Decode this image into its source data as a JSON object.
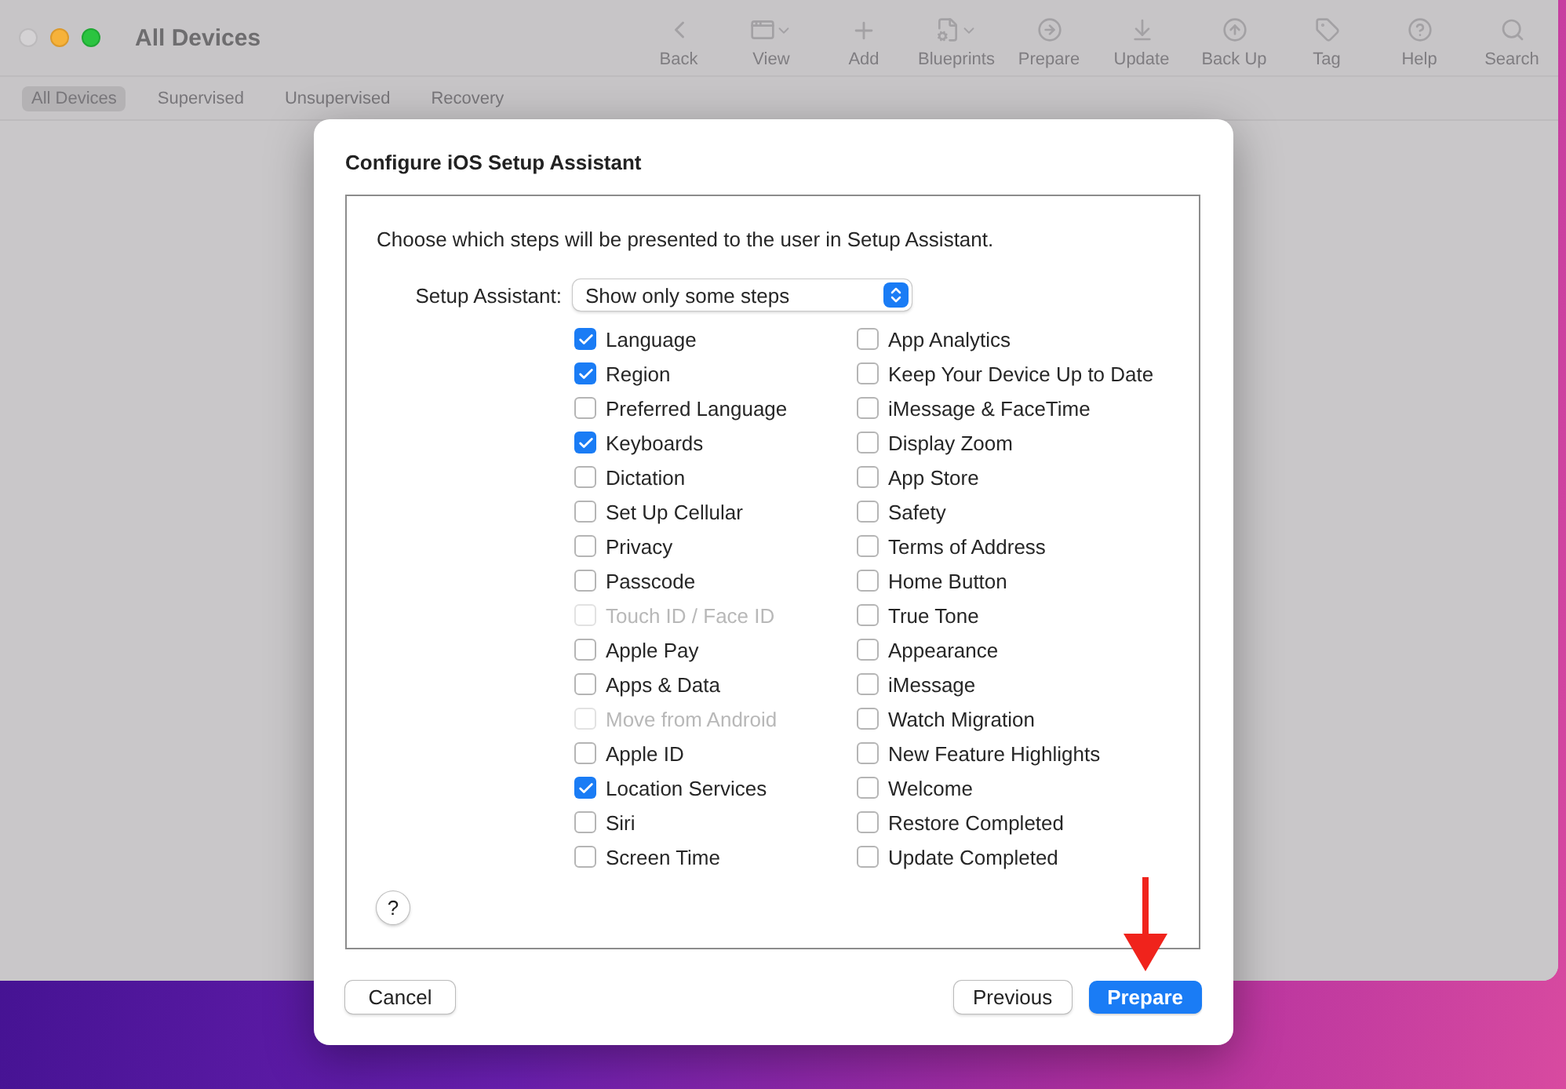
{
  "window": {
    "title": "All Devices"
  },
  "toolbar": [
    {
      "label": "Back",
      "kind": "back"
    },
    {
      "label": "View",
      "kind": "view"
    },
    {
      "label": "Add",
      "kind": "add"
    },
    {
      "label": "Blueprints",
      "kind": "blueprints"
    },
    {
      "label": "Prepare",
      "kind": "prepare"
    },
    {
      "label": "Update",
      "kind": "update"
    },
    {
      "label": "Back Up",
      "kind": "backup"
    },
    {
      "label": "Tag",
      "kind": "tag"
    },
    {
      "label": "Help",
      "kind": "help"
    },
    {
      "label": "Search",
      "kind": "search"
    }
  ],
  "tabs": [
    {
      "label": "All Devices",
      "selected": true
    },
    {
      "label": "Supervised",
      "selected": false
    },
    {
      "label": "Unsupervised",
      "selected": false
    },
    {
      "label": "Recovery",
      "selected": false
    }
  ],
  "sheet": {
    "title": "Configure iOS Setup Assistant",
    "description": "Choose which steps will be presented to the user in Setup Assistant.",
    "select_label": "Setup Assistant:",
    "select_value": "Show only some steps",
    "help": "?",
    "columns": [
      [
        {
          "label": "Language",
          "checked": true,
          "disabled": false
        },
        {
          "label": "Region",
          "checked": true,
          "disabled": false
        },
        {
          "label": "Preferred Language",
          "checked": false,
          "disabled": false
        },
        {
          "label": "Keyboards",
          "checked": true,
          "disabled": false
        },
        {
          "label": "Dictation",
          "checked": false,
          "disabled": false
        },
        {
          "label": "Set Up Cellular",
          "checked": false,
          "disabled": false
        },
        {
          "label": "Privacy",
          "checked": false,
          "disabled": false
        },
        {
          "label": "Passcode",
          "checked": false,
          "disabled": false
        },
        {
          "label": "Touch ID / Face ID",
          "checked": false,
          "disabled": true
        },
        {
          "label": "Apple Pay",
          "checked": false,
          "disabled": false
        },
        {
          "label": "Apps & Data",
          "checked": false,
          "disabled": false
        },
        {
          "label": "Move from Android",
          "checked": false,
          "disabled": true
        },
        {
          "label": "Apple ID",
          "checked": false,
          "disabled": false
        },
        {
          "label": "Location Services",
          "checked": true,
          "disabled": false
        },
        {
          "label": "Siri",
          "checked": false,
          "disabled": false
        },
        {
          "label": "Screen Time",
          "checked": false,
          "disabled": false
        }
      ],
      [
        {
          "label": "App Analytics",
          "checked": false,
          "disabled": false
        },
        {
          "label": "Keep Your Device Up to Date",
          "checked": false,
          "disabled": false
        },
        {
          "label": "iMessage & FaceTime",
          "checked": false,
          "disabled": false
        },
        {
          "label": "Display Zoom",
          "checked": false,
          "disabled": false
        },
        {
          "label": "App Store",
          "checked": false,
          "disabled": false
        },
        {
          "label": "Safety",
          "checked": false,
          "disabled": false
        },
        {
          "label": "Terms of Address",
          "checked": false,
          "disabled": false
        },
        {
          "label": "Home Button",
          "checked": false,
          "disabled": false
        },
        {
          "label": "True Tone",
          "checked": false,
          "disabled": false
        },
        {
          "label": "Appearance",
          "checked": false,
          "disabled": false
        },
        {
          "label": "iMessage",
          "checked": false,
          "disabled": false
        },
        {
          "label": "Watch Migration",
          "checked": false,
          "disabled": false
        },
        {
          "label": "New Feature Highlights",
          "checked": false,
          "disabled": false
        },
        {
          "label": "Welcome",
          "checked": false,
          "disabled": false
        },
        {
          "label": "Restore Completed",
          "checked": false,
          "disabled": false
        },
        {
          "label": "Update Completed",
          "checked": false,
          "disabled": false
        }
      ]
    ],
    "buttons": [
      {
        "label": "Cancel",
        "kind": "secondary"
      },
      {
        "label": "Previous",
        "kind": "secondary"
      },
      {
        "label": "Prepare",
        "kind": "primary"
      }
    ]
  }
}
